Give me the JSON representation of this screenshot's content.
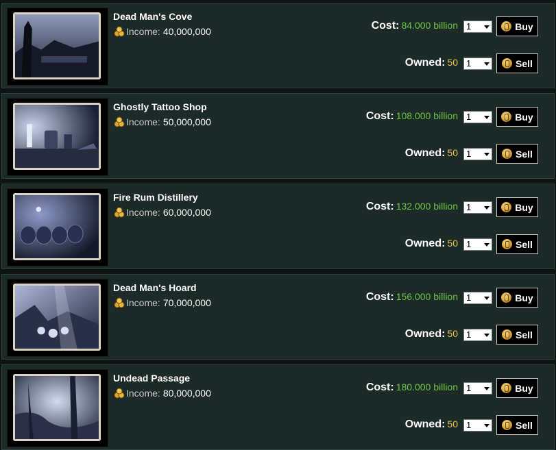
{
  "properties": [
    {
      "name": "Dead Man's Cove",
      "income_label": "Income:",
      "income": "40,000,000",
      "cost_label": "Cost:",
      "cost": "84.000 billion",
      "owned_label": "Owned:",
      "owned": "50",
      "buy_qty": "1",
      "sell_qty": "1",
      "buy_label": "Buy",
      "sell_label": "Sell"
    },
    {
      "name": "Ghostly Tattoo Shop",
      "income_label": "Income:",
      "income": "50,000,000",
      "cost_label": "Cost:",
      "cost": "108.000 billion",
      "owned_label": "Owned:",
      "owned": "50",
      "buy_qty": "1",
      "sell_qty": "1",
      "buy_label": "Buy",
      "sell_label": "Sell"
    },
    {
      "name": "Fire Rum Distillery",
      "income_label": "Income:",
      "income": "60,000,000",
      "cost_label": "Cost:",
      "cost": "132.000 billion",
      "owned_label": "Owned:",
      "owned": "50",
      "buy_qty": "1",
      "sell_qty": "1",
      "buy_label": "Buy",
      "sell_label": "Sell"
    },
    {
      "name": "Dead Man's Hoard",
      "income_label": "Income:",
      "income": "70,000,000",
      "cost_label": "Cost:",
      "cost": "156.000 billion",
      "owned_label": "Owned:",
      "owned": "50",
      "buy_qty": "1",
      "sell_qty": "1",
      "buy_label": "Buy",
      "sell_label": "Sell"
    },
    {
      "name": "Undead Passage",
      "income_label": "Income:",
      "income": "80,000,000",
      "cost_label": "Cost:",
      "cost": "180.000 billion",
      "owned_label": "Owned:",
      "owned": "50",
      "buy_qty": "1",
      "sell_qty": "1",
      "buy_label": "Buy",
      "sell_label": "Sell"
    }
  ],
  "colors": {
    "cost": "#6fc443",
    "owned": "#e8c44a",
    "panel": "#1c2a28"
  },
  "icons": {
    "income": "coins-icon",
    "button": "gold-coin-icon",
    "select": "chevron-down-icon"
  }
}
